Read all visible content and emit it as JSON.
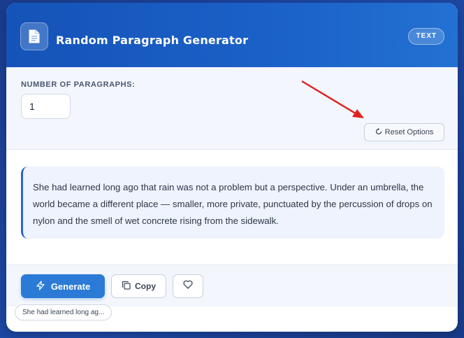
{
  "header": {
    "title": "Random Paragraph Generator",
    "badge": "TEXT",
    "icon": "document-icon"
  },
  "options": {
    "paragraphs_label": "NUMBER OF PARAGRAPHS:",
    "paragraphs_value": "1",
    "reset_label": "Reset Options",
    "reset_icon": "refresh-icon"
  },
  "result": {
    "text": "She had learned long ago that rain was not a problem but a perspective. Under an umbrella, the world became a different place — smaller, more private, punctuated by the percussion of drops on nylon and the smell of wet concrete rising from the sidewalk."
  },
  "actions": {
    "generate_label": "Generate",
    "generate_icon": "lightning-icon",
    "copy_label": "Copy",
    "copy_icon": "copy-icon",
    "favorite_icon": "heart-icon"
  },
  "history": {
    "items": [
      "She had learned long ag..."
    ]
  },
  "colors": {
    "accent": "#2b7bd6",
    "header": "#1b61c8",
    "annotation_arrow": "#e02020"
  }
}
